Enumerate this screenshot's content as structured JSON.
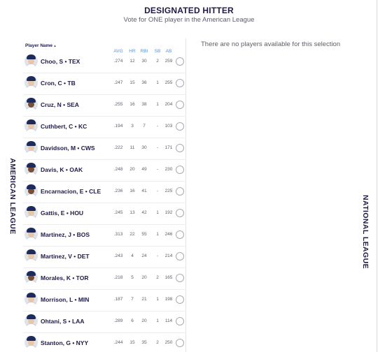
{
  "header": {
    "title": "DESIGNATED HITTER",
    "subtitle": "Vote for ONE player in the American League"
  },
  "leagues": {
    "left": "AMERICAN LEAGUE",
    "right": "NATIONAL LEAGUE"
  },
  "table": {
    "columns": {
      "name": "Player Name",
      "avg": "AVG",
      "hr": "HR",
      "rbi": "RBI",
      "sb": "SB",
      "ab": "AB"
    },
    "sort_indicator": "▲",
    "players": [
      {
        "name": "Choo, S • TEX",
        "avg": ".274",
        "hr": "12",
        "rbi": "30",
        "sb": "2",
        "ab": "259",
        "skin": "light"
      },
      {
        "name": "Cron, C • TB",
        "avg": ".247",
        "hr": "15",
        "rbi": "36",
        "sb": "1",
        "ab": "255",
        "skin": "light"
      },
      {
        "name": "Cruz, N • SEA",
        "avg": ".255",
        "hr": "16",
        "rbi": "38",
        "sb": "1",
        "ab": "204",
        "skin": "dark"
      },
      {
        "name": "Cuthbert, C • KC",
        "avg": ".194",
        "hr": "3",
        "rbi": "7",
        "sb": "-",
        "ab": "103",
        "skin": "light"
      },
      {
        "name": "Davidson, M • CWS",
        "avg": ".222",
        "hr": "11",
        "rbi": "30",
        "sb": "-",
        "ab": "171",
        "skin": "light"
      },
      {
        "name": "Davis, K • OAK",
        "avg": ".248",
        "hr": "20",
        "rbi": "49",
        "sb": "-",
        "ab": "230",
        "skin": "dark"
      },
      {
        "name": "Encarnacion, E • CLE",
        "avg": ".236",
        "hr": "16",
        "rbi": "41",
        "sb": "-",
        "ab": "225",
        "skin": "dark"
      },
      {
        "name": "Gattis, E • HOU",
        "avg": ".245",
        "hr": "13",
        "rbi": "42",
        "sb": "1",
        "ab": "192",
        "skin": "light"
      },
      {
        "name": "Martinez, J • BOS",
        "avg": ".313",
        "hr": "22",
        "rbi": "55",
        "sb": "1",
        "ab": "246",
        "skin": "light"
      },
      {
        "name": "Martinez, V • DET",
        "avg": ".243",
        "hr": "4",
        "rbi": "24",
        "sb": "-",
        "ab": "214",
        "skin": "light"
      },
      {
        "name": "Morales, K • TOR",
        "avg": ".218",
        "hr": "5",
        "rbi": "20",
        "sb": "2",
        "ab": "165",
        "skin": "dark"
      },
      {
        "name": "Morrison, L • MIN",
        "avg": ".187",
        "hr": "7",
        "rbi": "21",
        "sb": "1",
        "ab": "198",
        "skin": "light"
      },
      {
        "name": "Ohtani, S • LAA",
        "avg": ".289",
        "hr": "6",
        "rbi": "20",
        "sb": "1",
        "ab": "114",
        "skin": "light"
      },
      {
        "name": "Stanton, G • NYY",
        "avg": ".244",
        "hr": "15",
        "rbi": "35",
        "sb": "2",
        "ab": "250",
        "skin": "light"
      }
    ]
  },
  "national_panel": {
    "empty_message": "There are no players available for this selection"
  },
  "colors": {
    "navy": "#1d1a48",
    "stat_header": "#5a8fd6",
    "muted": "#5f5e6c"
  }
}
